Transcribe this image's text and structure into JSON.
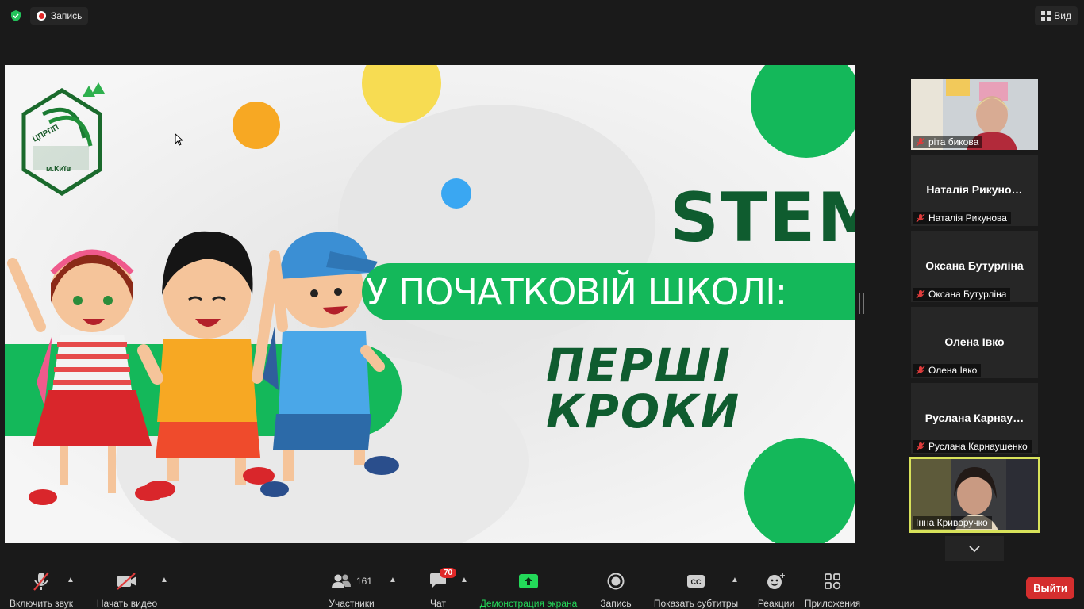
{
  "topbar": {
    "recording_label": "Запись",
    "view_label": "Вид"
  },
  "slide": {
    "logo_text": "ЦПРПП",
    "logo_city": "м.Київ",
    "title": "STEM",
    "subtitle": "У ПОЧАТКОВІЙ ШКОЛІ:",
    "subtitle2": "ПЕРШІ КРОКИ"
  },
  "participants_panel": {
    "tiles": [
      {
        "name": "ріта бикова",
        "display": "",
        "video": true
      },
      {
        "name": "Наталія Рикунова",
        "display": "Наталія  Рикуно…",
        "video": false
      },
      {
        "name": "Оксана Бутурліна",
        "display": "Оксана Бутурліна",
        "video": false
      },
      {
        "name": "Олена Івко",
        "display": "Олена Івко",
        "video": false
      },
      {
        "name": "Руслана Карнаушенко",
        "display": "Руслана  Карнау…",
        "video": false
      },
      {
        "name": "Інна Криворучко",
        "display": "",
        "video": true,
        "active_speaker": true
      }
    ]
  },
  "toolbar": {
    "audio_label": "Включить звук",
    "video_label": "Начать видео",
    "participants_label": "Участники",
    "participants_count": "161",
    "chat_label": "Чат",
    "chat_badge": "70",
    "share_label": "Демонстрация экрана",
    "record_label": "Запись",
    "captions_label": "Показать субтитры",
    "reactions_label": "Реакции",
    "apps_label": "Приложения",
    "leave_label": "Выйти"
  },
  "colors": {
    "share_green": "#23d959",
    "leave_red": "#d42e2e",
    "active_border": "#d8e25a",
    "slide_green": "#14b85a",
    "slide_dark_green": "#0f5c2f"
  }
}
